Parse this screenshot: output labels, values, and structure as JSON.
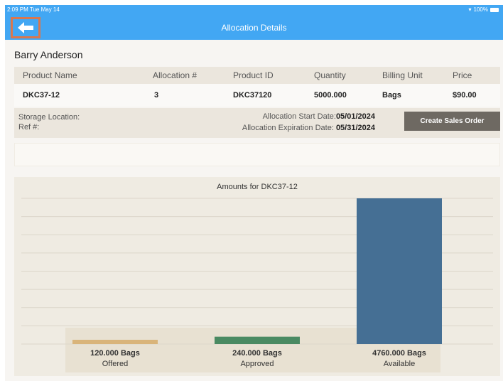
{
  "status_bar": {
    "time": "2:09 PM   Tue May 14",
    "battery": "100%"
  },
  "nav": {
    "title": "Allocation Details",
    "back_icon": "back-arrow-icon"
  },
  "customer": {
    "name": "Barry Anderson"
  },
  "table": {
    "headers": [
      "Product Name",
      "Allocation #",
      "Product ID",
      "Quantity",
      "Billing Unit",
      "Price"
    ],
    "row": [
      "DKC37-12",
      "3",
      "DKC37120",
      "5000.000",
      "Bags",
      "$90.00"
    ]
  },
  "info": {
    "storage_label": "Storage Location:",
    "ref_label": "Ref #:",
    "start_label": "Allocation Start Date:",
    "start_value": "05/01/2024",
    "expiration_label": "Allocation Expiration Date:",
    "expiration_value": "05/31/2024",
    "create_button": "Create Sales Order"
  },
  "chart_data": {
    "type": "bar",
    "title": "Amounts for DKC37-12",
    "categories": [
      "Offered",
      "Approved",
      "Available"
    ],
    "values": [
      120,
      240,
      4760
    ],
    "value_labels": [
      "120.000 Bags",
      "240.000 Bags",
      "4760.000 Bags"
    ],
    "colors": [
      "#d9b47a",
      "#4a8a62",
      "#456f94"
    ],
    "ylim": [
      0,
      4760
    ],
    "grid": true
  }
}
